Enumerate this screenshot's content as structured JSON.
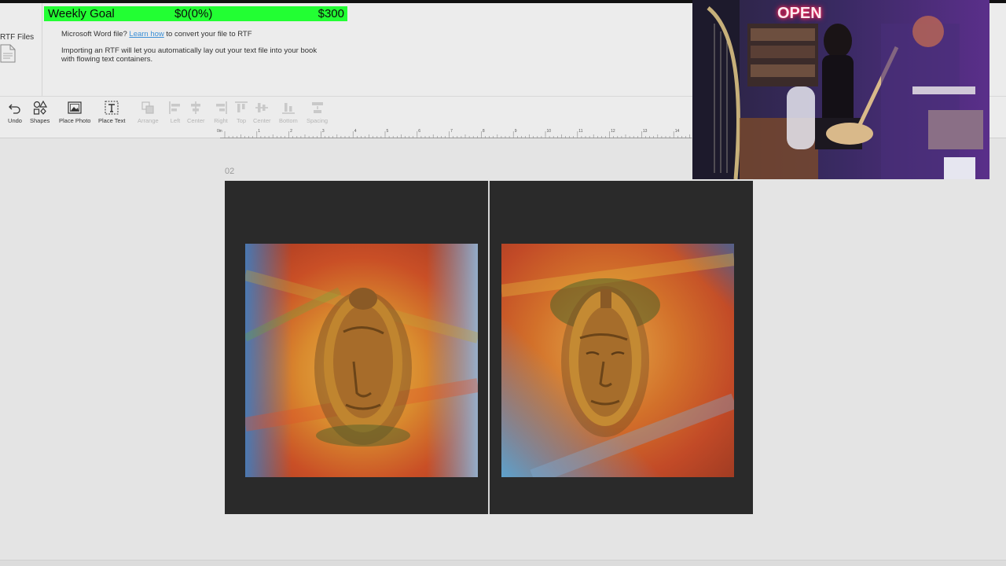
{
  "goal": {
    "label": "Weekly Goal",
    "current": "$0(0%)",
    "target": "$300",
    "progress": 0
  },
  "sidebar": {
    "rtf_label": "RTF Files"
  },
  "info": {
    "line1_before": "Microsoft Word file? ",
    "line1_link": "Learn how",
    "line1_after": " to convert your file to RTF",
    "line2": "Importing an RTF will let you automatically lay out your text file into your book with flowing text containers."
  },
  "toolbar": {
    "undo": "Undo",
    "shapes": "Shapes",
    "place_photo": "Place Photo",
    "place_text": "Place Text",
    "arrange": "Arrange",
    "left": "Left",
    "center_h": "Center",
    "right": "Right",
    "top": "Top",
    "center_v": "Center",
    "bottom": "Bottom",
    "spacing": "Spacing"
  },
  "ruler": {
    "zero": "0in",
    "marks": [
      "1",
      "2",
      "3",
      "4",
      "5",
      "6",
      "7",
      "8",
      "9",
      "10",
      "11",
      "12",
      "13",
      "14"
    ]
  },
  "canvas": {
    "page_number": "02"
  },
  "webcam": {
    "sign": "OPEN"
  }
}
